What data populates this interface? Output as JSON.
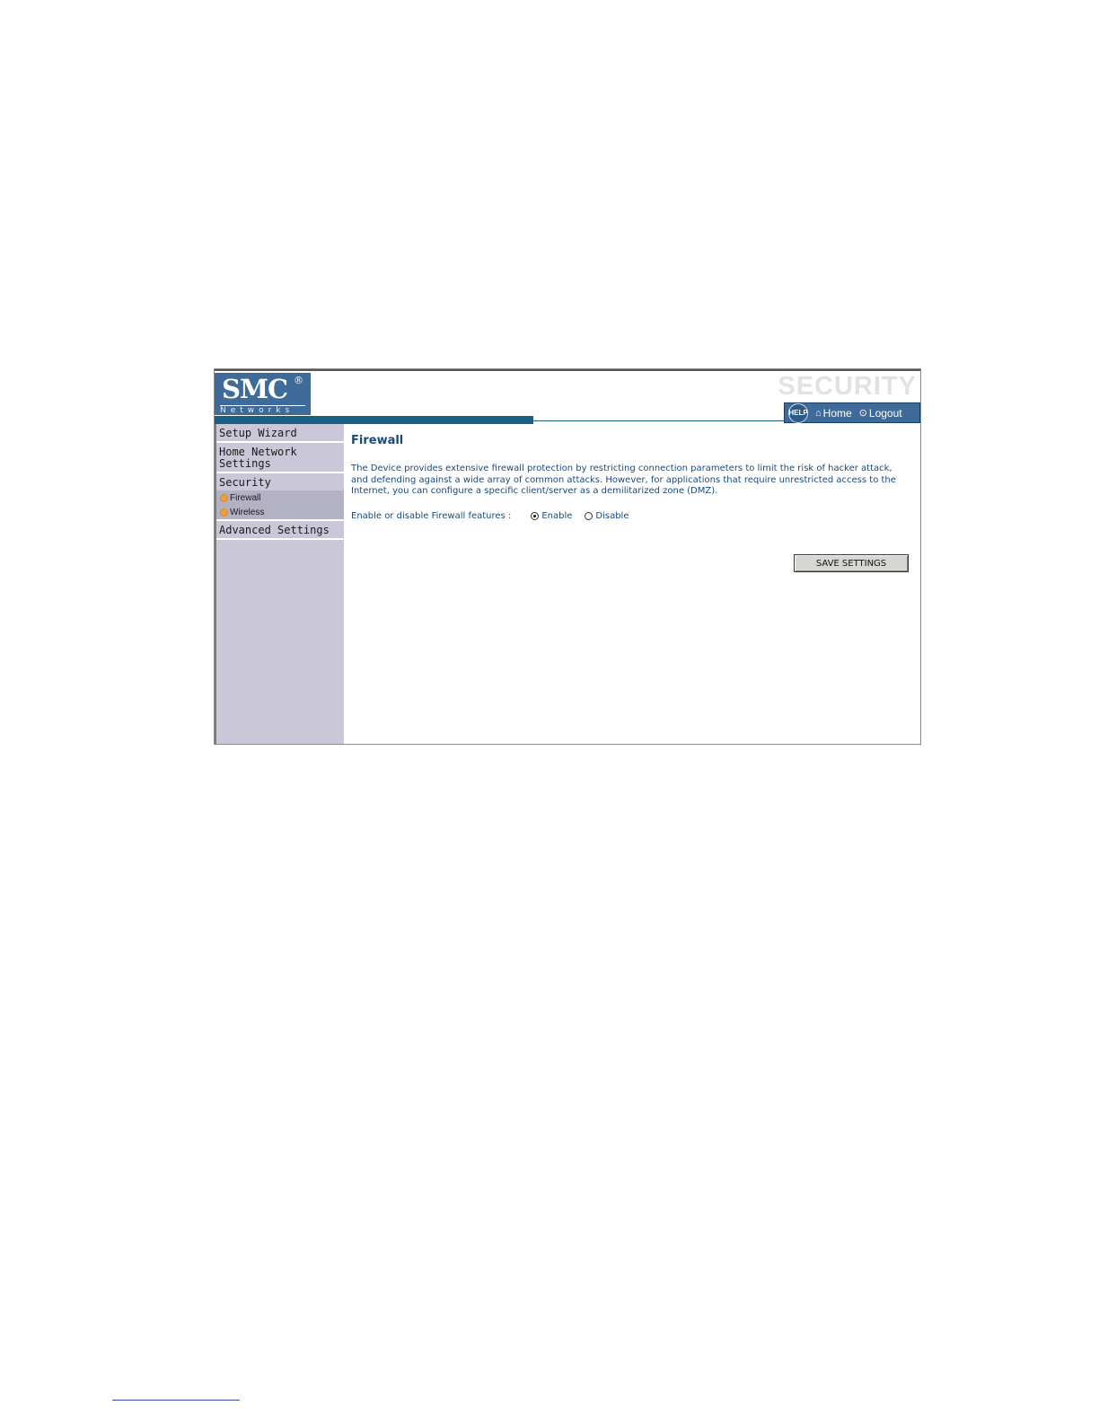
{
  "header": {
    "brand": "SMC",
    "brand_mark": "®",
    "brand_sub": "Networks",
    "section_title": "SECURITY",
    "help_label": "HELP",
    "home_label": "Home",
    "logout_label": "Logout"
  },
  "sidebar": {
    "items": [
      {
        "label": "Setup Wizard"
      },
      {
        "label": "Home Network Settings"
      },
      {
        "label": "Security"
      },
      {
        "label": "Advanced Settings"
      }
    ],
    "sub_items": [
      {
        "label": "Firewall"
      },
      {
        "label": "Wireless"
      }
    ]
  },
  "main": {
    "title": "Firewall",
    "description": "The Device provides extensive firewall protection by restricting connection parameters to limit the risk of hacker attack, and defending against a wide array of common attacks. However, for applications that require unrestricted access to the Internet, you can configure a specific client/server as a demilitarized zone (DMZ).",
    "firewall_label": "Enable or disable Firewall features :",
    "options": {
      "enable": "Enable",
      "disable": "Disable"
    },
    "selected": "Enable",
    "save_label": "SAVE SETTINGS"
  },
  "colors": {
    "brand_blue": "#3e6b99",
    "accent_line": "#1a5f86",
    "sidebar_bg": "#cac8d8",
    "text_blue": "#1a4a7a"
  }
}
